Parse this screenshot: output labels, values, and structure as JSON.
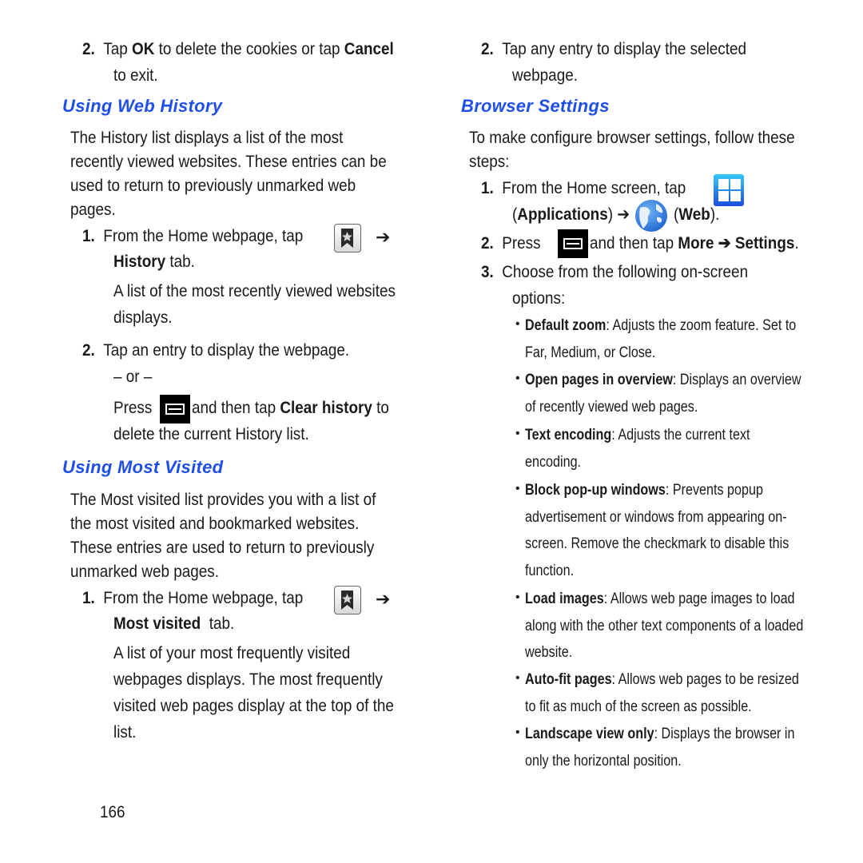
{
  "page_number": "166",
  "colors": {
    "heading": "#1f4fe8",
    "text": "#1a1a1a"
  },
  "left": {
    "step_cookies": {
      "num": "2.",
      "pre": "Tap ",
      "ok": "OK",
      "mid": " to delete the cookies or tap ",
      "cancel": "Cancel",
      "line2": "to exit."
    },
    "web_history": {
      "heading": "Using Web History",
      "intro": [
        "The History list displays a list of the most",
        "recently viewed websites. These entries can be",
        "used to return to previously unmarked web",
        "pages."
      ],
      "step1": {
        "num": "1.",
        "text": "From the Home webpage, tap",
        "icon": "bookmark-star-icon",
        "arrow": "➔",
        "tab_bold": "History",
        "tab_rest": " tab.",
        "result": [
          "A list of the most recently viewed websites",
          "displays."
        ]
      },
      "step2": {
        "num": "2.",
        "text": "Tap an entry to display the webpage.",
        "or": "– or –",
        "press": "Press",
        "icon": "menu-key-icon",
        "then": " and then tap ",
        "clear_bold": "Clear history",
        "to": " to",
        "line2": "delete the current History list."
      }
    },
    "most_visited": {
      "heading": "Using Most Visited",
      "intro": [
        "The Most visited list provides you with a list of",
        "the most visited and bookmarked websites.",
        "These entries are used to return to previously",
        "unmarked web pages."
      ],
      "step1": {
        "num": "1.",
        "text": "From the Home webpage, tap",
        "icon": "bookmark-star-icon",
        "arrow": "➔",
        "tab_bold": "Most visited",
        "tab_rest": "  tab.",
        "result": [
          "A list of your most frequently visited",
          "webpages displays. The most frequently",
          "visited web pages display at the top of the",
          "list."
        ]
      }
    }
  },
  "right": {
    "step_entry": {
      "num": "2.",
      "line1": "Tap any entry to display the selected",
      "line2": "webpage."
    },
    "browser_settings": {
      "heading": "Browser Settings",
      "intro": [
        "To make configure browser settings, follow these",
        "steps:"
      ],
      "step1": {
        "num": "1.",
        "text": "From the Home screen, tap",
        "apps_icon": "applications-icon",
        "open": "(",
        "apps_bold": "Applications",
        "close_arrow": ") ➔",
        "web_icon": "web-globe-icon",
        "web_open": "(",
        "web_bold": "Web",
        "web_close": ")."
      },
      "step2": {
        "num": "2.",
        "press": "Press",
        "icon": "menu-key-icon",
        "then": " and then tap ",
        "more_bold": "More ➔ Settings",
        "end": "."
      },
      "step3": {
        "num": "3.",
        "line1": "Choose from the following on-screen",
        "line2": "options:"
      },
      "options": [
        {
          "name": "Default zoom",
          "lines": [
            ": Adjusts the zoom feature. Set to",
            "Far, Medium, or Close."
          ]
        },
        {
          "name": "Open pages in overview",
          "lines": [
            ": Displays an overview",
            "of recently viewed web pages."
          ]
        },
        {
          "name": "Text encoding",
          "lines": [
            ": Adjusts the current text",
            "encoding."
          ]
        },
        {
          "name": "Block pop-up windows",
          "lines": [
            ": Prevents popup",
            "advertisement or windows from appearing on-",
            "screen. Remove the checkmark to disable this",
            "function."
          ]
        },
        {
          "name": "Load images",
          "lines": [
            ": Allows web page images to load",
            "along with the other text components of a loaded",
            "website."
          ]
        },
        {
          "name": "Auto-fit pages",
          "lines": [
            ": Allows web pages to be resized",
            "to fit as much of the screen as possible."
          ]
        },
        {
          "name": "Landscape view only",
          "lines": [
            ": Displays the browser in",
            "only the horizontal position."
          ]
        }
      ]
    }
  }
}
